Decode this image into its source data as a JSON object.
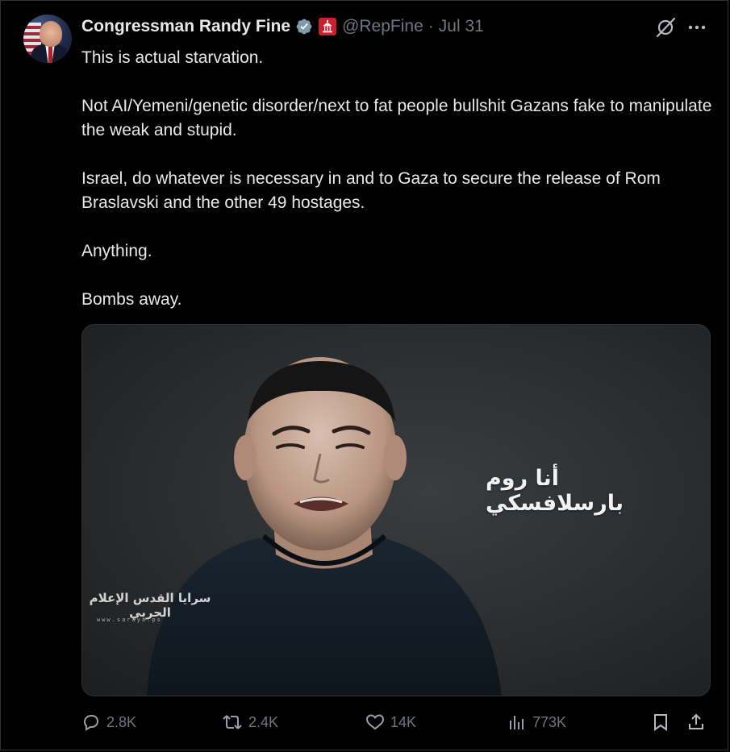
{
  "author": {
    "display_name": "Congressman Randy Fine",
    "handle": "@RepFine",
    "separator": "·",
    "date": "Jul 31",
    "verified_icon": "verified-badge-icon",
    "affiliation_icon": "government-badge-icon"
  },
  "tweet": {
    "paragraphs": [
      "This is actual starvation.",
      "Not AI/Yemeni/genetic disorder/next to fat people bullshit Gazans fake to manipulate the weak and stupid.",
      "Israel, do whatever is necessary in and to Gaza to secure the release of Rom Braslavski and the other 49 hostages.",
      "Anything.",
      "Bombs away."
    ]
  },
  "media": {
    "overlay_caption": "أنا روم بارسلافسكي",
    "watermark_text": "سرايا القدس الإعلام الحربي",
    "watermark_url": "www.saraya.ps"
  },
  "actions": {
    "reply_count": "2.8K",
    "repost_count": "2.4K",
    "like_count": "14K",
    "views_count": "773K"
  },
  "colors": {
    "background": "#000000",
    "text_primary": "#e7e9ea",
    "text_secondary": "#71767b",
    "verified_blue": "#829aab",
    "gov_badge_red": "#c8202f",
    "border": "#2f3336"
  }
}
